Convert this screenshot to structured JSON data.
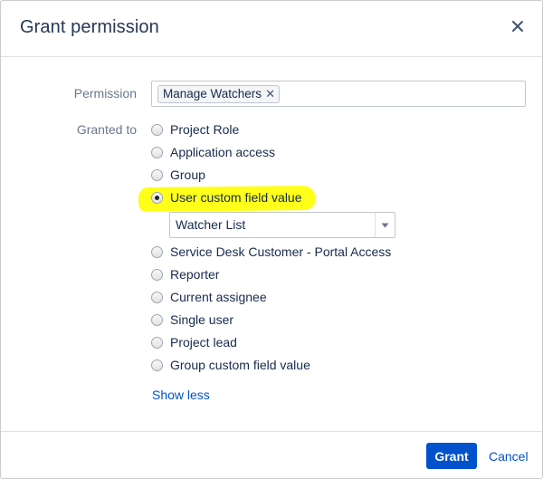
{
  "dialog": {
    "title": "Grant permission",
    "close_icon": "close-icon"
  },
  "form": {
    "permission_label": "Permission",
    "permission_value": "Manage Watchers",
    "remove_icon": "remove-x-icon",
    "granted_to_label": "Granted to",
    "options": [
      {
        "label": "Project Role",
        "checked": false
      },
      {
        "label": "Application access",
        "checked": false
      },
      {
        "label": "Group",
        "checked": false
      },
      {
        "label": "User custom field value",
        "checked": true
      },
      {
        "label": "Service Desk Customer - Portal Access",
        "checked": false
      },
      {
        "label": "Reporter",
        "checked": false
      },
      {
        "label": "Current assignee",
        "checked": false
      },
      {
        "label": "Single user",
        "checked": false
      },
      {
        "label": "Project lead",
        "checked": false
      },
      {
        "label": "Group custom field value",
        "checked": false
      }
    ],
    "custom_field_select": {
      "value": "Watcher List",
      "dropdown_icon": "chevron-down-icon"
    },
    "show_less": "Show less"
  },
  "footer": {
    "grant_label": "Grant",
    "cancel_label": "Cancel"
  },
  "colors": {
    "accent": "#0052cc",
    "highlight": "#ffff1a"
  }
}
